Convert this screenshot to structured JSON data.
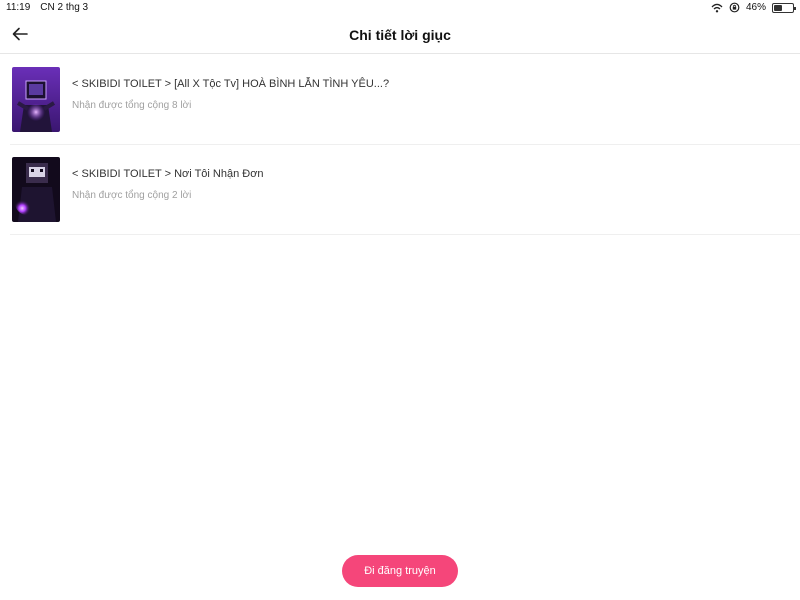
{
  "status_bar": {
    "time": "11:19",
    "date": "CN 2 thg 3",
    "battery": "46%",
    "battery_level": 0.46,
    "icons": [
      "wifi-icon",
      "orientation-lock-icon",
      "battery-icon"
    ]
  },
  "header": {
    "back_icon": "arrow-left-icon",
    "title": "Chi tiết lời giục"
  },
  "items": [
    {
      "title": "< SKIBIDI TOILET > [All X Tộc Tv] HOÀ BÌNH LẪN TÌNH YÊU...?",
      "subtitle": "Nhận được tổng cộng 8 lời"
    },
    {
      "title": "< SKIBIDI TOILET > Nơi Tôi Nhận Đơn",
      "subtitle": "Nhận được tổng cộng 2 lời"
    }
  ],
  "footer": {
    "button_label": "Đi đăng truyện"
  },
  "colors": {
    "accent": "#f5467a",
    "divider": "#efefef",
    "subtitle": "#a0a0a0"
  }
}
